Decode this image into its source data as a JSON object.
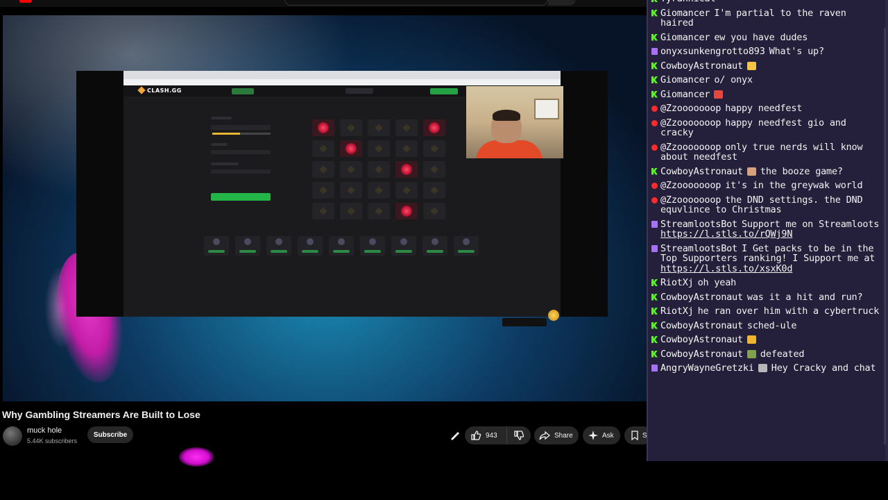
{
  "video": {
    "title": "Why Gambling Streamers Are Built to Lose",
    "channel_name": "muck hole",
    "subscribers": "5.44K subscribers",
    "subscribe_label": "Subscribe",
    "like_count": "943",
    "share_label": "Share",
    "ask_label": "Ask",
    "save_label": "S"
  },
  "game": {
    "brand": "CLASH.GG"
  },
  "chat": {
    "messages": [
      {
        "platform": "kick",
        "user": "",
        "text": "Tyrannical"
      },
      {
        "platform": "kick",
        "user": "Giomancer",
        "text": "I'm partial to the raven haired"
      },
      {
        "platform": "kick",
        "user": "Giomancer",
        "text": "ew you have dudes"
      },
      {
        "platform": "twitch",
        "user": "onyxsunkengrotto893",
        "text": "What's up?"
      },
      {
        "platform": "kick",
        "user": "CowboyAstronaut",
        "text": "",
        "emote": "emote-wave"
      },
      {
        "platform": "kick",
        "user": "Giomancer",
        "text": "o/ onyx"
      },
      {
        "platform": "kick",
        "user": "Giomancer",
        "text": "",
        "emote": "emote-heart"
      },
      {
        "platform": "yt",
        "user": "@Zzooooooop",
        "text": "happy needfest"
      },
      {
        "platform": "yt",
        "user": "@Zzooooooop",
        "text": "happy needfest gio and cracky"
      },
      {
        "platform": "yt",
        "user": "@Zzooooooop",
        "text": "only true nerds will know about needfest"
      },
      {
        "platform": "kick",
        "user": "CowboyAstronaut",
        "text": "the booze game?",
        "emote": "emote-face"
      },
      {
        "platform": "yt",
        "user": "@Zzooooooop",
        "text": "it's in the greywak world"
      },
      {
        "platform": "yt",
        "user": "@Zzooooooop",
        "text": "the DND settings. the DND equvlince to Christmas"
      },
      {
        "platform": "twitch",
        "user": "StreamlootsBot",
        "text": "Support me on Streamloots",
        "link": "https://l.stls.to/rQWj9N"
      },
      {
        "platform": "twitch",
        "user": "StreamlootsBot",
        "text": "I Get packs to be in the Top Supporters ranking! I Support me at",
        "link": "https://l.stls.to/xsxK0d"
      },
      {
        "platform": "kick",
        "user": "RiotXj",
        "text": "oh yeah"
      },
      {
        "platform": "kick",
        "user": "CowboyAstronaut",
        "text": "was it a hit and run?"
      },
      {
        "platform": "kick",
        "user": "RiotXj",
        "text": "he ran over him with a cybertruck"
      },
      {
        "platform": "kick",
        "user": "CowboyAstronaut",
        "text": "sched-ule"
      },
      {
        "platform": "kick",
        "user": "CowboyAstronaut",
        "text": "",
        "emote": "emote-cheer"
      },
      {
        "platform": "kick",
        "user": "CowboyAstronaut",
        "text": "defeated",
        "emote": "emote-hat"
      },
      {
        "platform": "twitch",
        "user": "AngryWayneGretzki",
        "text": "Hey Cracky and chat",
        "emote": "emote-hockey"
      }
    ]
  },
  "colors": {
    "chat_bg": "#241f3a",
    "kick": "#53fc18",
    "twitch": "#a970ff",
    "youtube": "#ff2b2b",
    "accent_green": "#24b548"
  }
}
